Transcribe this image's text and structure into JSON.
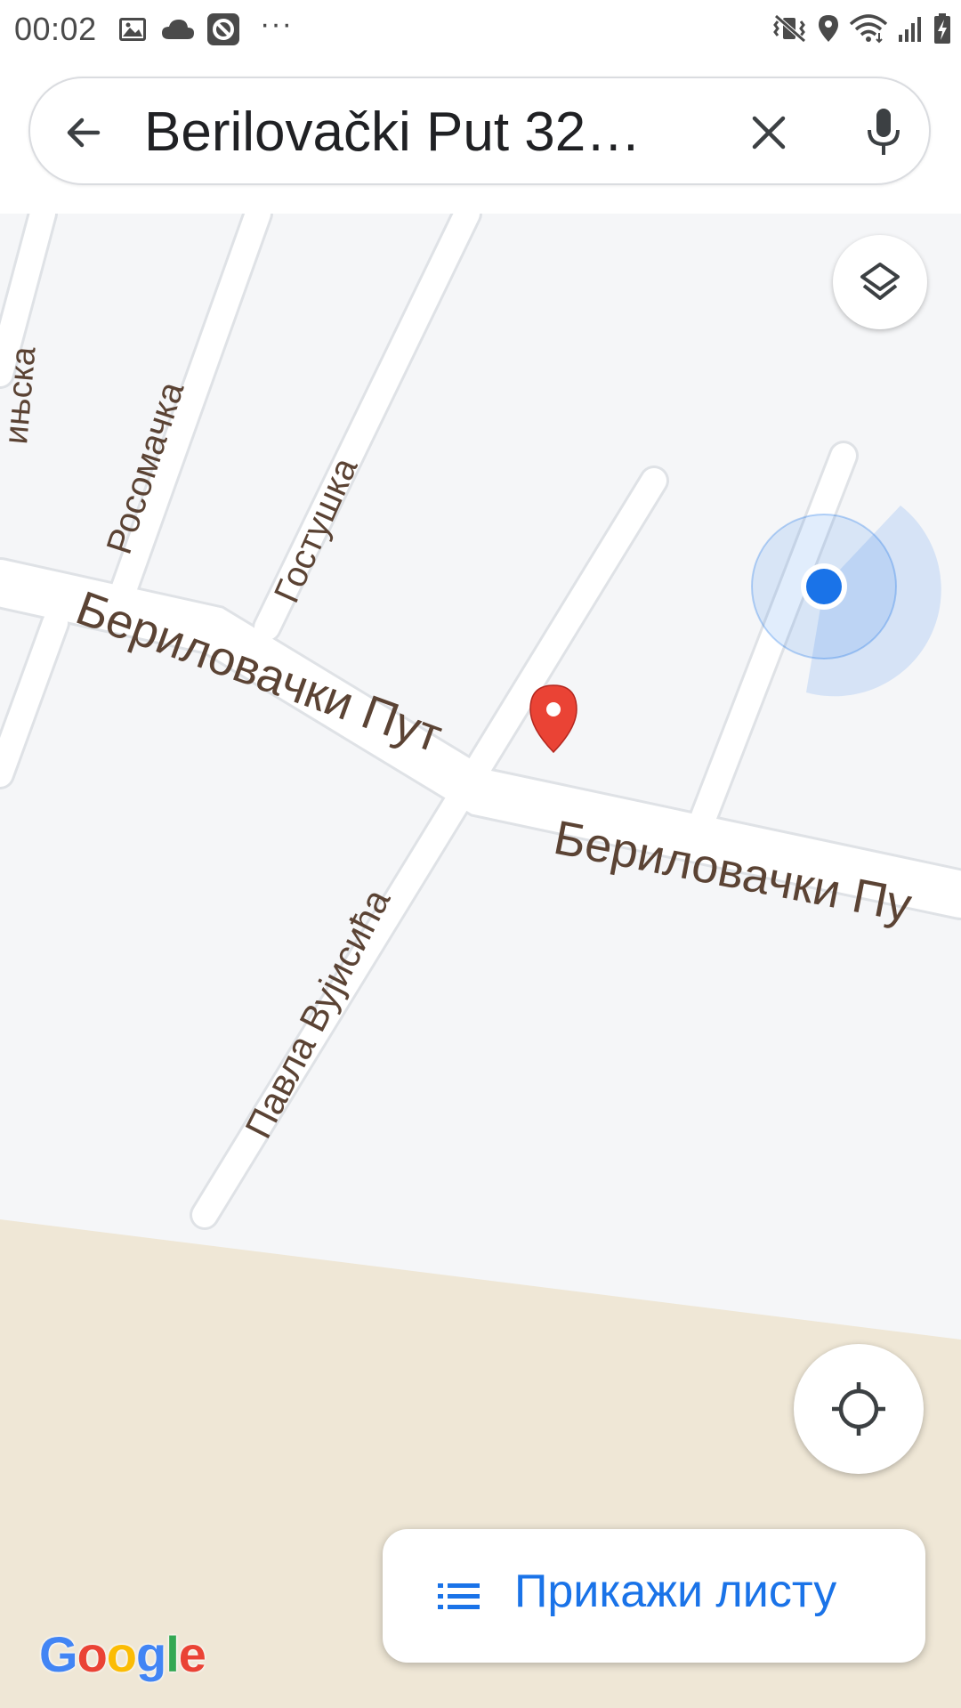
{
  "status_bar": {
    "time": "00:02",
    "icons_left": [
      "image-icon",
      "cloud-icon",
      "app-icon",
      "more-dots-icon"
    ],
    "icons_right": [
      "mute-vibrate-icon",
      "location-icon",
      "wifi-icon",
      "signal-icon",
      "battery-charging-icon"
    ],
    "more_dots": "···"
  },
  "search": {
    "query": "Berilovački Put 32…",
    "back_icon": "arrow-left-icon",
    "clear_icon": "close-icon",
    "mic_icon": "microphone-icon"
  },
  "map": {
    "streets": {
      "main_west": "Бериловачки Пут",
      "main_east": "Бериловачки Пу",
      "rosomachka": "Росомачка",
      "gostushka": "Гостушка",
      "pavla": "Павла Вујисића",
      "edge": "ињска"
    },
    "colors": {
      "land": "#f5f6f8",
      "road": "#ffffff",
      "road_edge": "#dfe2e6",
      "terrain": "#efe7d6",
      "marker": "#ea4335",
      "my_location": "#1a73e8"
    },
    "layers_icon": "layers-icon",
    "locate_icon": "my-location-crosshair-icon",
    "marker_icon": "map-pin-icon"
  },
  "list_button": {
    "label": "Прикажи листу",
    "icon": "list-icon"
  },
  "logo": {
    "letters": [
      "G",
      "o",
      "o",
      "g",
      "l",
      "e"
    ],
    "colors": [
      "#4285f4",
      "#ea4335",
      "#fbbc05",
      "#4285f4",
      "#34a853",
      "#ea4335"
    ]
  }
}
